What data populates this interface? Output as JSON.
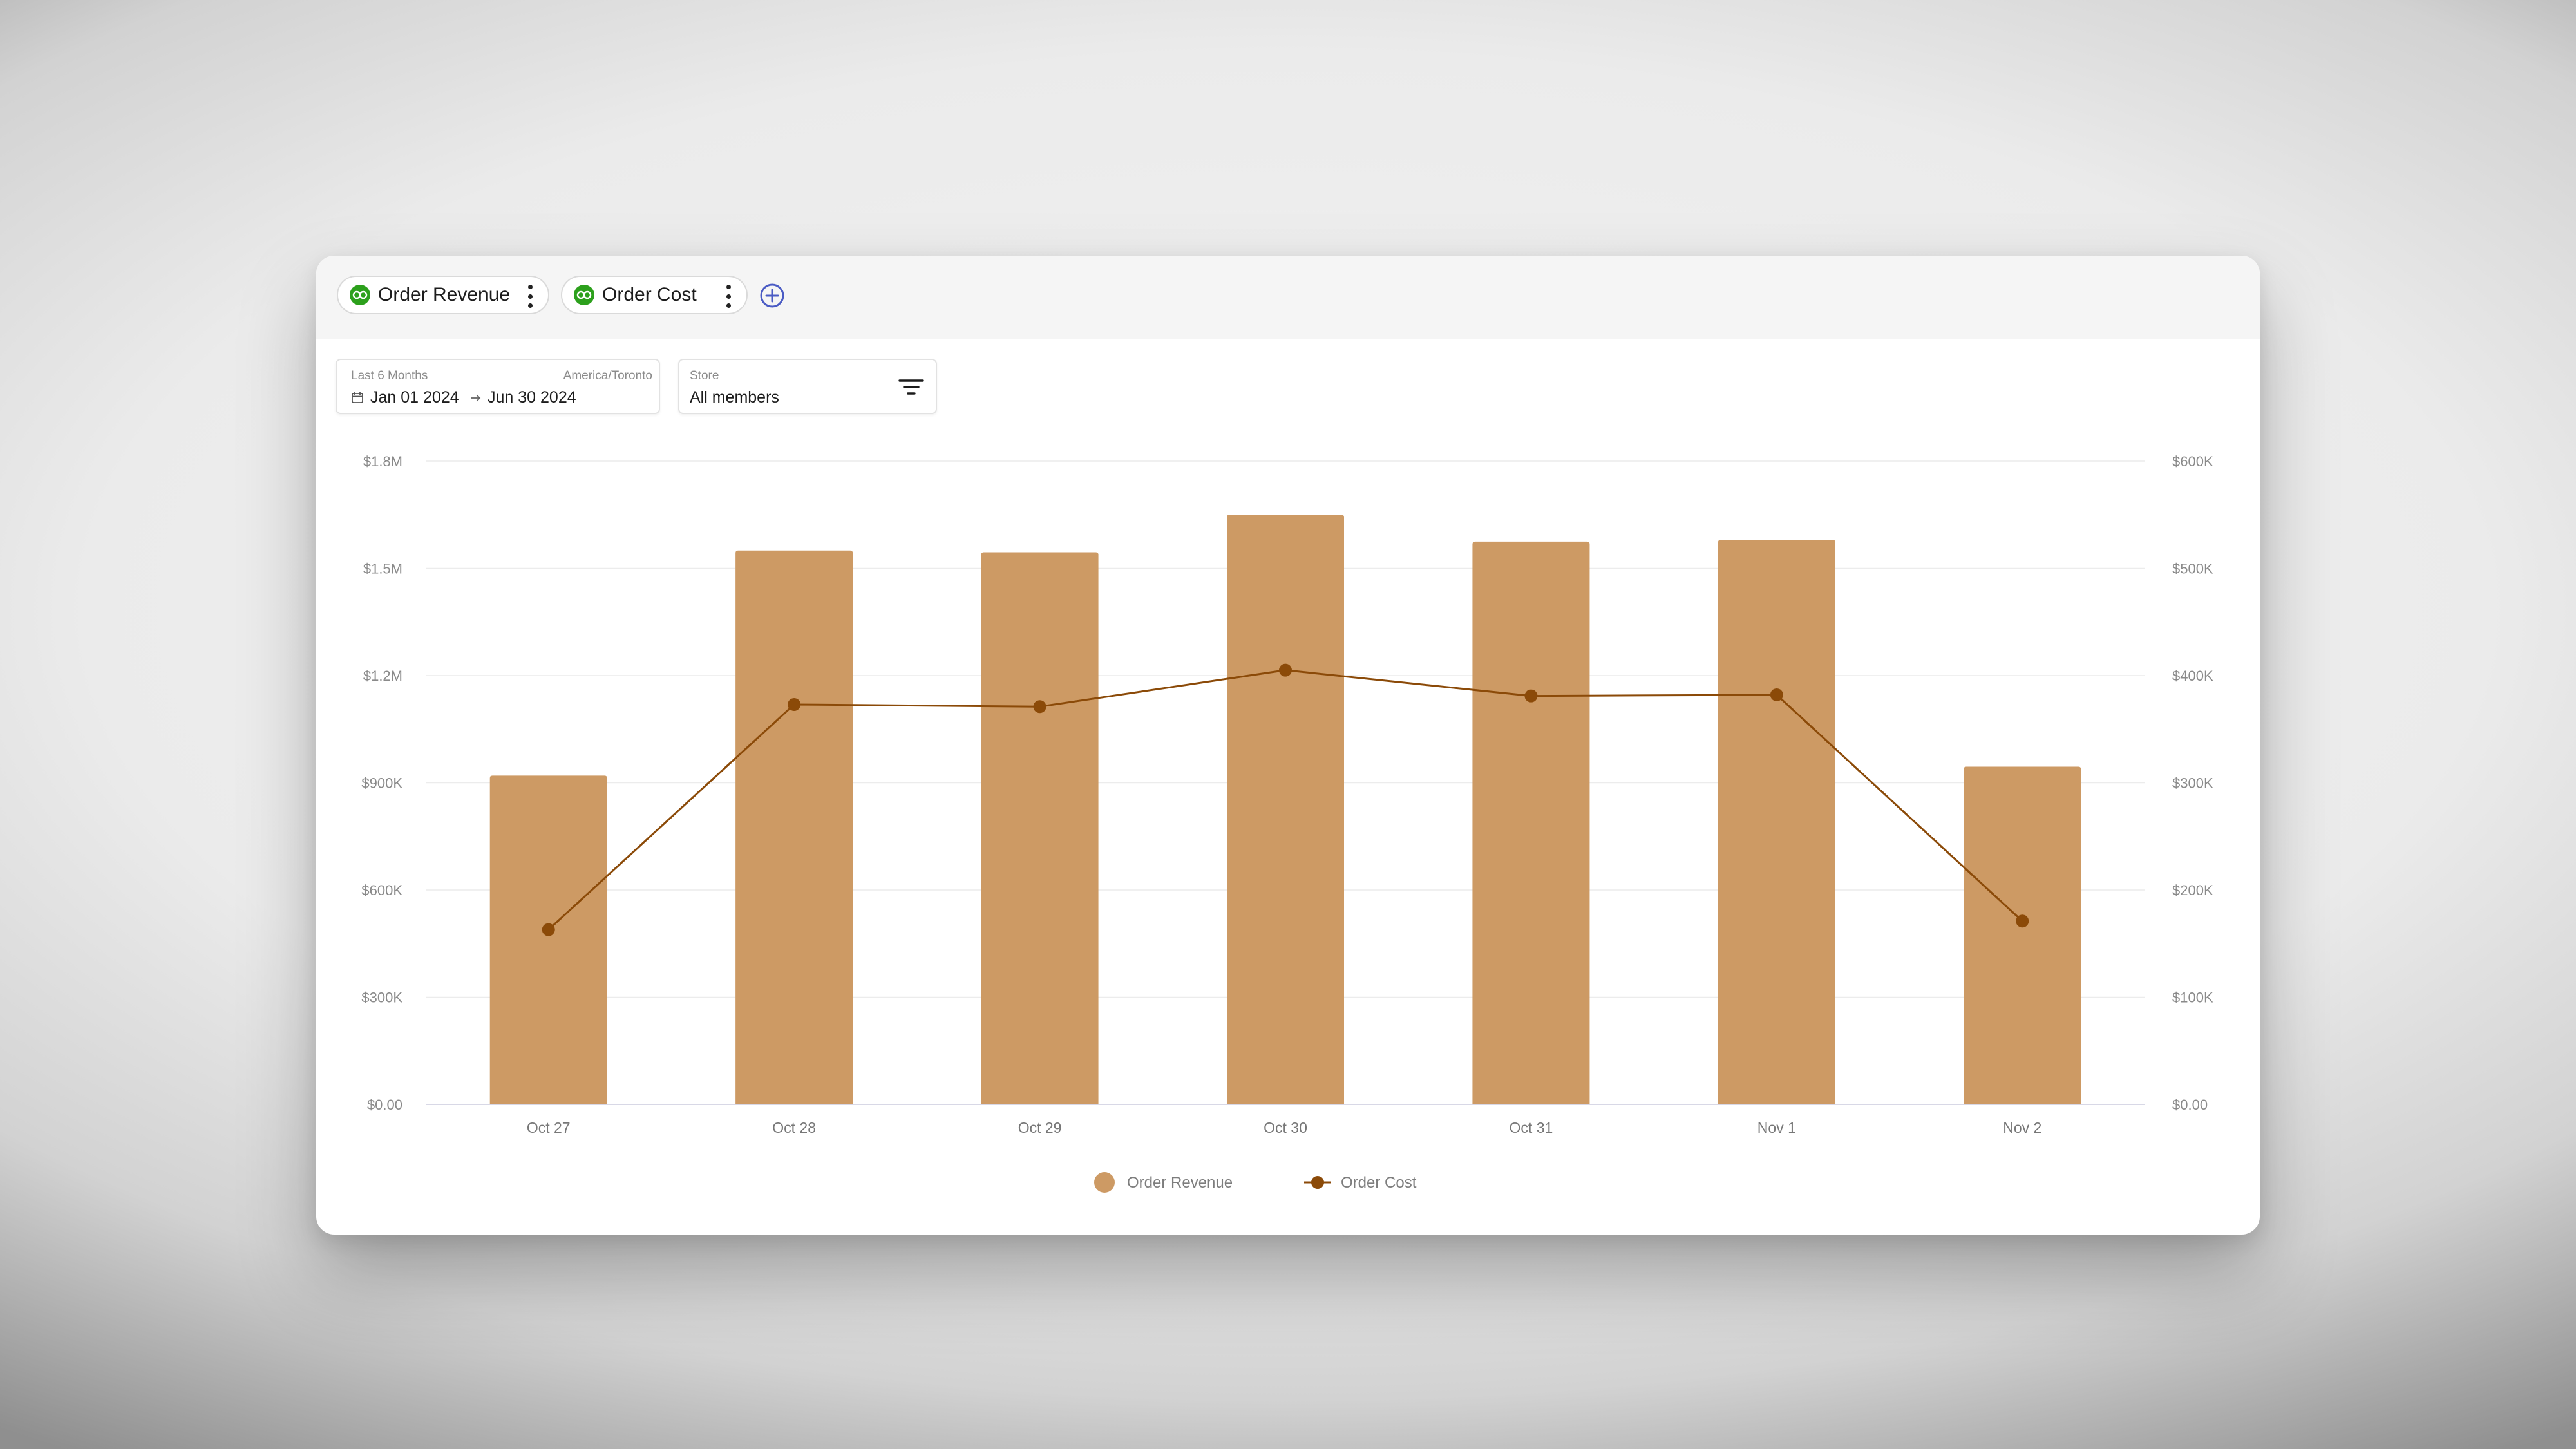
{
  "tabs": [
    {
      "label": "Order Revenue",
      "icon": "quickbooks-logo-icon"
    },
    {
      "label": "Order Cost",
      "icon": "quickbooks-logo-icon"
    }
  ],
  "add_tab_icon": "plus-circle-icon",
  "date_filter": {
    "range_label": "Last 6 Months",
    "timezone": "America/Toronto",
    "start": "Jan 01 2024",
    "end": "Jun 30 2024",
    "icon": "calendar-icon"
  },
  "store_filter": {
    "label": "Store",
    "value": "All members",
    "icon": "filter-lines-icon"
  },
  "colors": {
    "bar": "#cd9a64",
    "line": "#8b4a08",
    "grid": "#ececec",
    "brand": "#2ca01c",
    "add": "#4a5bc4"
  },
  "chart_data": {
    "type": "bar",
    "categories": [
      "Oct 27",
      "Oct 28",
      "Oct 29",
      "Oct 30",
      "Oct 31",
      "Nov 1",
      "Nov 2"
    ],
    "series": [
      {
        "name": "Order Revenue",
        "type": "bar",
        "axis": "left",
        "values": [
          920000,
          1550000,
          1545000,
          1650000,
          1575000,
          1580000,
          945000
        ]
      },
      {
        "name": "Order Cost",
        "type": "line",
        "axis": "right",
        "values": [
          163000,
          373000,
          371000,
          405000,
          381000,
          382000,
          171000
        ]
      }
    ],
    "y_left": {
      "min": 0,
      "max": 1800000,
      "ticks": [
        "$0.00",
        "$300K",
        "$600K",
        "$900K",
        "$1.2M",
        "$1.5M",
        "$1.8M"
      ]
    },
    "y_right": {
      "min": 0,
      "max": 600000,
      "ticks": [
        "$0.00",
        "$100K",
        "$200K",
        "$300K",
        "$400K",
        "$500K",
        "$600K"
      ]
    },
    "grid": true,
    "legend": "bottom-center"
  }
}
